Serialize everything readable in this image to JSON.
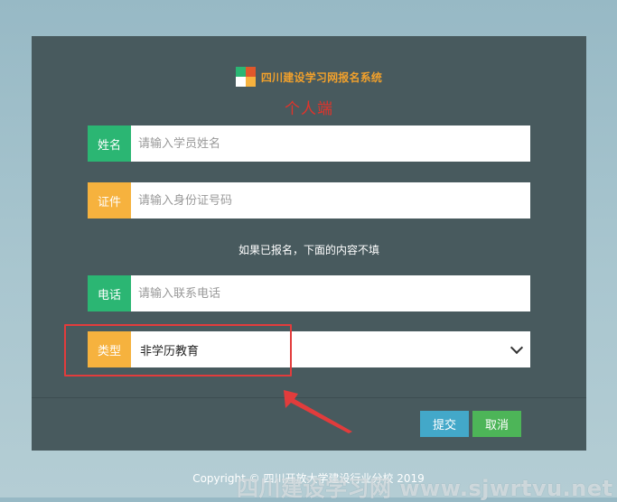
{
  "system_title": "四川建设学习网报名系统",
  "subtitle": "个人端",
  "logo": {
    "colors": [
      "#2bb673",
      "#e0572b",
      "#ffffff",
      "#f6b23e"
    ]
  },
  "fields": {
    "name": {
      "label": "姓名",
      "placeholder": "请输入学员姓名",
      "color": "#2bb673"
    },
    "id_card": {
      "label": "证件",
      "placeholder": "请输入身份证号码",
      "color": "#f6b23e"
    },
    "phone": {
      "label": "电话",
      "placeholder": "请输入联系电话",
      "color": "#2bb673"
    },
    "type": {
      "label": "类型",
      "selected": "非学历教育",
      "color": "#f6b23e"
    }
  },
  "note": "如果已报名，下面的内容不填",
  "buttons": {
    "submit": "提交",
    "cancel": "取消"
  },
  "copyright": "Copyright © 四川开放大学建设行业分校 2019",
  "watermark": "四川建设学习网 www.sjwrtvu.net"
}
